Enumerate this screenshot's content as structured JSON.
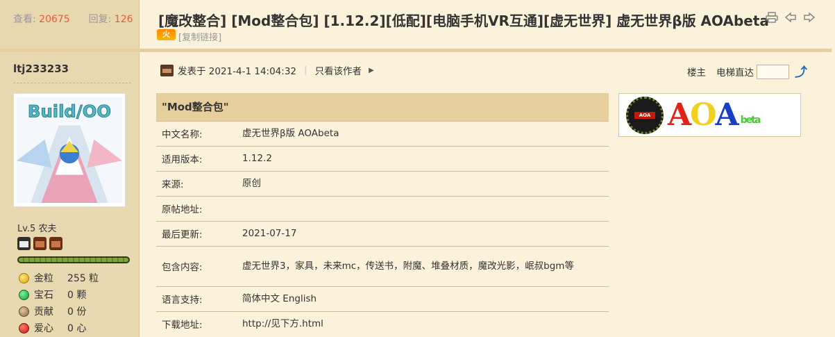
{
  "thread": {
    "views_label": "查看:",
    "views": "20675",
    "replies_label": "回复:",
    "replies": "126",
    "title": "[魔改整合] [Mod整合包] [1.12.2][低配][电脑手机VR互通][虚无世界] 虚无世界β版 AOAbeta",
    "hot_badge": "火",
    "copy_link": "[复制链接]",
    "toolbar_icons": [
      "print-icon",
      "prev-thread-icon",
      "next-thread-icon"
    ]
  },
  "author": {
    "name": "ltj233233",
    "avatar_text": "Build/OO",
    "level": "Lv.5 农夫",
    "xp_fill": 1.0,
    "stats": [
      {
        "icon": "gold-nugget-icon",
        "label": "金粒",
        "value": "255 粒"
      },
      {
        "icon": "gem-icon",
        "label": "宝石",
        "value": "0 颗"
      },
      {
        "icon": "contribution-icon",
        "label": "贡献",
        "value": "0 份"
      },
      {
        "icon": "heart-apple-icon",
        "label": "爱心",
        "value": "0 心"
      }
    ]
  },
  "post": {
    "posted_label": "发表于 2021-4-1 14:04:32",
    "only_author": "只看该作者",
    "floor_label": "楼主",
    "jump_label": "电梯直达",
    "jump_value": ""
  },
  "mod_table": {
    "header": "\"Mod整合包\"",
    "rows": [
      {
        "key": "中文名称:",
        "value": "虚无世界β版 AOAbeta"
      },
      {
        "key": "适用版本:",
        "value": "1.12.2"
      },
      {
        "key": "来源:",
        "value": "原创"
      },
      {
        "key": "原帖地址:",
        "value": ""
      },
      {
        "key": "最后更新:",
        "value": "2021-07-17"
      },
      {
        "key": "包含内容:",
        "value": "虚无世界3，家具，未来mc，传送书，附魔、堆叠材质，魔改光影，岷叔bgm等"
      },
      {
        "key": "语言支持:",
        "value": "简体中文 English"
      },
      {
        "key": "下载地址:",
        "value": "http://见下方.html"
      }
    ]
  },
  "logo": {
    "badge": "AOA",
    "letters": [
      "A",
      "O",
      "A"
    ],
    "suffix": "beta"
  },
  "colors": {
    "page_bg": "#fbf2db",
    "sidebar_bg": "#e8d8b0",
    "header_bar": "#e6cf9c",
    "accent_number": "#e65b3c"
  }
}
